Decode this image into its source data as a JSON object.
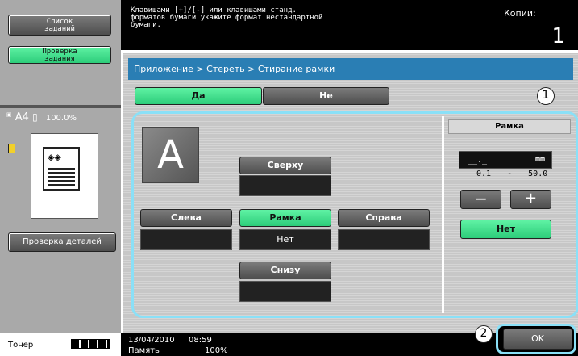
{
  "sidebar": {
    "job_list_label": "Список\nзаданий",
    "job_check_label": "Проверка\nзадания",
    "paper_info": "A4",
    "zoom": "100.0%",
    "check_details_label": "Проверка деталей",
    "toner_label": "Тонер"
  },
  "header": {
    "message": "Клавишами [+]/[-] или клавишами станд.\nформатов бумаги укажите формат нестандартной\nбумаги.",
    "copies_label": "Копии:",
    "copies_value": "1"
  },
  "breadcrumb": {
    "text": "Приложение > Стереть > Стирание рамки"
  },
  "toggle": {
    "yes_label": "Да",
    "no_label": "Не"
  },
  "callouts": {
    "one": "1",
    "two": "2"
  },
  "erase": {
    "preview_letter": "A",
    "top_label": "Сверху",
    "left_label": "Слева",
    "frame_label": "Рамка",
    "frame_value": "Нет",
    "right_label": "Справа",
    "bottom_label": "Снизу"
  },
  "frame_panel": {
    "title": "Рамка",
    "value_placeholder": "__._",
    "unit": "mm",
    "range_min": "0.1",
    "range_dash": "-",
    "range_max": "50.0",
    "minus_label": "−",
    "plus_label": "+",
    "none_label": "Нет"
  },
  "status": {
    "date": "13/04/2010",
    "time": "08:59",
    "memory_label": "Память",
    "memory_value": "100%",
    "ok_label": "OK"
  }
}
